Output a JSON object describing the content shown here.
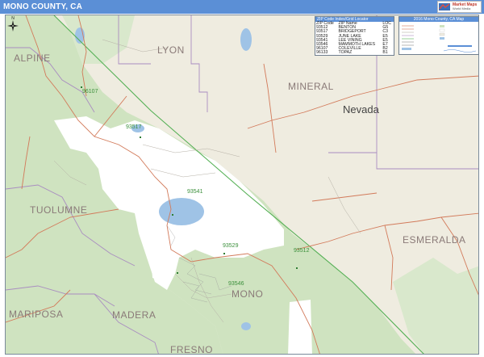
{
  "header": {
    "title": "MONO COUNTY, CA"
  },
  "logo": {
    "brand_line": "Market Maps",
    "sub_line": "World Media"
  },
  "map": {
    "counties": {
      "alpine": "ALPINE",
      "lyon": "LYON",
      "mineral": "MINERAL",
      "tuolumne": "TUOLUMNE",
      "esmeralda": "ESMERALDA",
      "mariposa": "MARIPOSA",
      "madera": "MADERA",
      "mono": "MONO",
      "fresno": "FRESNO"
    },
    "states": {
      "nevada": "Nevada"
    },
    "zip_labels": {
      "z96107": "96107",
      "z93517": "93517",
      "z93541": "93541",
      "z93529": "93529",
      "z93512": "93512",
      "z93546": "93546"
    },
    "colors": {
      "land": "#efece0",
      "forest": "#cfe3c0",
      "urban": "#ffffff",
      "water": "#9fc3e6",
      "county_line": "#a98dc0",
      "state_line": "#55b055",
      "road": "#d27a5a"
    }
  },
  "zip_legend": {
    "title": "ZIP Code Index/Grid Locator",
    "columns": [
      "ZIP Code",
      "ZIP Name",
      "LOC"
    ],
    "rows": [
      [
        "93512",
        "BENTON",
        "G5"
      ],
      [
        "93517",
        "BRIDGEPORT",
        "C3"
      ],
      [
        "93529",
        "JUNE LAKE",
        "E5"
      ],
      [
        "93541",
        "LEE VINING",
        "E5"
      ],
      [
        "93546",
        "MAMMOTH LAKES",
        "E7"
      ],
      [
        "96107",
        "COLEVILLE",
        "B2"
      ],
      [
        "96133",
        "TOPAZ",
        "B1"
      ]
    ]
  },
  "map_legend": {
    "title": "2016 Mono County, CA Map"
  },
  "compass": {
    "icon": "compass-rose-icon"
  }
}
